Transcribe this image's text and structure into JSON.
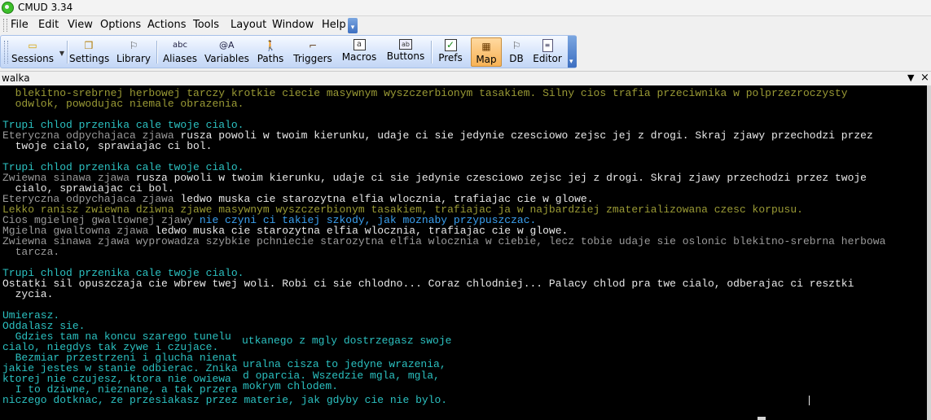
{
  "window": {
    "title": "CMUD 3.34"
  },
  "menu": [
    "File",
    "Edit",
    "View",
    "Options",
    "Actions",
    "Tools",
    "Layout",
    "Window",
    "Help"
  ],
  "toolbar": {
    "buttons": [
      {
        "label": "Sessions",
        "icon": "folder-icon"
      },
      {
        "label": "Settings",
        "icon": "settings-icon"
      },
      {
        "label": "Library",
        "icon": "library-icon"
      },
      {
        "label": "Aliases",
        "icon": "aliases-icon",
        "glyph": "abc"
      },
      {
        "label": "Variables",
        "icon": "variables-icon",
        "glyph": "@A"
      },
      {
        "label": "Paths",
        "icon": "paths-icon"
      },
      {
        "label": "Triggers",
        "icon": "triggers-icon"
      },
      {
        "label": "Macros",
        "icon": "macros-icon"
      },
      {
        "label": "Buttons",
        "icon": "buttons-icon",
        "glyph": "ab"
      },
      {
        "label": "Prefs",
        "icon": "prefs-icon"
      },
      {
        "label": "Map",
        "icon": "map-icon",
        "active": true
      },
      {
        "label": "DB",
        "icon": "db-icon"
      },
      {
        "label": "Editor",
        "icon": "editor-icon"
      }
    ]
  },
  "session_window": {
    "name": "walka",
    "dropdown_glyph": "▼",
    "close_glyph": "×"
  },
  "output_lines": [
    [
      {
        "t": "  blekitno-srebrnej herbowej tarczy krotkie ciecie masywnym wyszczerbionym tasakiem. Silny cios trafia przeciwnika w polprzezroczysty",
        "c": "olive"
      }
    ],
    [
      {
        "t": "  odwlok, powodujac niemale obrazenia.",
        "c": "olive"
      }
    ],
    [],
    [
      {
        "t": "Trupi chlod przenika cale twoje cialo.",
        "c": "cyan"
      }
    ],
    [
      {
        "t": "Eteryczna odpychajaca zjawa ",
        "c": "gray"
      },
      {
        "t": "rusza powoli w twoim kierunku, udaje ci sie jedynie czesciowo zejsc jej z drogi. Skraj zjawy przechodzi przez",
        "c": "white"
      }
    ],
    [
      {
        "t": "  twoje cialo, sprawiajac ci bol.",
        "c": "white"
      }
    ],
    [],
    [
      {
        "t": "Trupi chlod przenika cale twoje cialo.",
        "c": "cyan"
      }
    ],
    [
      {
        "t": "Zwiewna sinawa zjawa ",
        "c": "gray"
      },
      {
        "t": "rusza powoli w twoim kierunku, udaje ci sie jedynie czesciowo zejsc jej z drogi. Skraj zjawy przechodzi przez twoje",
        "c": "white"
      }
    ],
    [
      {
        "t": "  cialo, sprawiajac ci bol.",
        "c": "white"
      }
    ],
    [
      {
        "t": "Eteryczna odpychajaca zjawa ",
        "c": "gray"
      },
      {
        "t": "ledwo muska cie starozytna elfia wlocznia, trafiajac cie w glowe.",
        "c": "white"
      }
    ],
    [
      {
        "t": "Lekko ranisz zwiewna dziwna zjawe masywnym wyszczerbionym tasakiem, trafiajac ja w najbardziej zmaterializowana czesc korpusu.",
        "c": "olive"
      }
    ],
    [
      {
        "t": "Cios mgielnej gwaltownej zjawy ",
        "c": "gray"
      },
      {
        "t": "nie czyni ci takiej szkody, jak moznaby przypuszczac.",
        "c": "blue"
      }
    ],
    [
      {
        "t": "Mgielna gwaltowna zjawa ",
        "c": "gray"
      },
      {
        "t": "ledwo muska cie starozytna elfia wlocznia, trafiajac cie w glowe.",
        "c": "white"
      }
    ],
    [
      {
        "t": "Zwiewna sinawa zjawa wyprowadza szybkie pchniecie starozytna elfia wlocznia w ciebie, lecz tobie udaje sie oslonic blekitno-srebrna herbowa",
        "c": "gray"
      }
    ],
    [
      {
        "t": "  tarcza.",
        "c": "gray"
      }
    ],
    [],
    [
      {
        "t": "Trupi chlod przenika cale twoje cialo.",
        "c": "cyan"
      }
    ],
    [
      {
        "t": "Ostatki sil opuszczaja cie wbrew twej woli. Robi ci sie chlodno... Coraz chlodniej... Palacy chlod pra twe cialo, odberajac ci resztki",
        "c": "white"
      }
    ],
    [
      {
        "t": "  zycia.",
        "c": "white"
      }
    ],
    [],
    [
      {
        "t": "Umierasz.",
        "c": "cyan"
      }
    ],
    [
      {
        "t": "Oddalasz sie.",
        "c": "cyan"
      }
    ],
    [
      {
        "t": "  Gdzies tam na koncu szarego tunelu",
        "c": "cyan"
      }
    ],
    [
      {
        "t": "cialo, niegdys tak zywe i czujace.",
        "c": "cyan"
      }
    ],
    [
      {
        "t": "  Bezmiar przestrzeni i glucha nienat",
        "c": "cyan"
      }
    ],
    [
      {
        "t": "jakie jestes w stanie odbierac. Znika",
        "c": "cyan"
      }
    ],
    [
      {
        "t": "ktorej nie czujesz, ktora nie owiewa",
        "c": "cyan"
      }
    ],
    [
      {
        "t": "  I to dziwne, nieznane, a tak przera",
        "c": "cyan"
      }
    ],
    [
      {
        "t": "niczego dotknac, ze przesiakasz przez materie, jak gdyby cie nie bylo.",
        "c": "cyan"
      }
    ]
  ],
  "overlay_lines": [
    "utkanego z mgly dostrzegasz swoje",
    "uralna cisza to jedyne wrazenia,",
    "d oparcia. Wszedzie mgla, mgla,",
    "mokrym chlodem."
  ]
}
